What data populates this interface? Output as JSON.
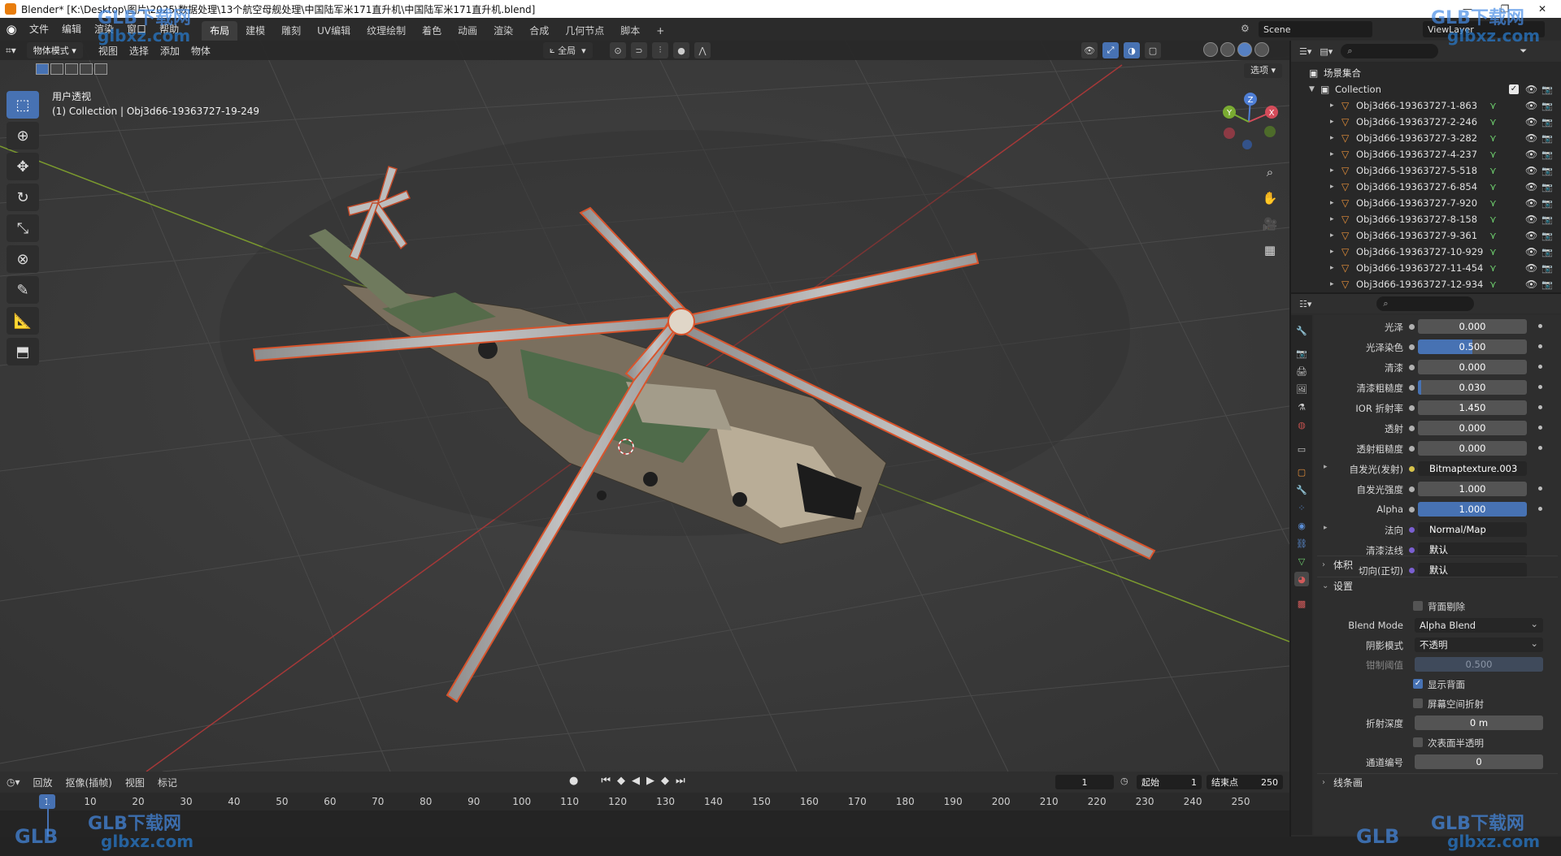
{
  "window": {
    "title": "Blender* [K:\\Desktop\\图片\\2025\\数据处理\\13个航空母舰处理\\中国陆军米171直升机\\中国陆军米171直升机.blend]",
    "buttons": [
      "—",
      "❐",
      "✕"
    ]
  },
  "menu": {
    "items": [
      "文件",
      "编辑",
      "渲染",
      "窗口",
      "帮助"
    ],
    "workspaces": [
      "布局",
      "建模",
      "雕刻",
      "UV编辑",
      "纹理绘制",
      "着色",
      "动画",
      "渲染",
      "合成",
      "几何节点",
      "脚本",
      "+"
    ],
    "active_workspace": "布局",
    "scene": "Scene",
    "view_layer": "ViewLayer"
  },
  "viewport": {
    "mode": "物体模式",
    "header_menus": [
      "视图",
      "选择",
      "添加",
      "物体"
    ],
    "transform_orientation": "全局",
    "options_label": "选项",
    "info_line1": "用户透视",
    "info_line2": "(1) Collection | Obj3d66-19363727-19-249",
    "gizmo_axes": [
      "Z",
      "X",
      "Y"
    ]
  },
  "toolbar": {
    "tools": [
      "select-box-icon",
      "cursor-icon",
      "move-icon",
      "rotate-icon",
      "scale-icon",
      "transform-icon",
      "annotate-icon",
      "measure-icon",
      "add-cube-icon"
    ]
  },
  "timeline": {
    "menus": [
      "回放",
      "抠像(插帧)",
      "视图",
      "标记"
    ],
    "current_frame": "1",
    "start_label": "起始",
    "start": "1",
    "end_label": "结束点",
    "end": "250",
    "ticks": [
      "1",
      "10",
      "20",
      "30",
      "40",
      "50",
      "60",
      "70",
      "80",
      "90",
      "100",
      "110",
      "120",
      "130",
      "140",
      "150",
      "160",
      "170",
      "180",
      "190",
      "200",
      "210",
      "220",
      "230",
      "240",
      "250"
    ]
  },
  "outliner": {
    "scene_collection": "场景集合",
    "collection": "Collection",
    "objects": [
      "Obj3d66-19363727-1-863",
      "Obj3d66-19363727-2-246",
      "Obj3d66-19363727-3-282",
      "Obj3d66-19363727-4-237",
      "Obj3d66-19363727-5-518",
      "Obj3d66-19363727-6-854",
      "Obj3d66-19363727-7-920",
      "Obj3d66-19363727-8-158",
      "Obj3d66-19363727-9-361",
      "Obj3d66-19363727-10-929",
      "Obj3d66-19363727-11-454",
      "Obj3d66-19363727-12-934"
    ]
  },
  "properties": {
    "fields": [
      {
        "label": "光泽",
        "value": "0.000",
        "style": "plain"
      },
      {
        "label": "光泽染色",
        "value": "0.500",
        "style": "half"
      },
      {
        "label": "清漆",
        "value": "0.000",
        "style": "plain"
      },
      {
        "label": "清漆粗糙度",
        "value": "0.030",
        "style": "partial"
      },
      {
        "label": "IOR 折射率",
        "value": "1.450",
        "style": "plain"
      },
      {
        "label": "透射",
        "value": "0.000",
        "style": "plain"
      },
      {
        "label": "透射粗糙度",
        "value": "0.000",
        "style": "plain"
      },
      {
        "label": "自发光(发射)",
        "value": "Bitmaptexture.003",
        "style": "text-yellow"
      },
      {
        "label": "自发光强度",
        "value": "1.000",
        "style": "plain"
      },
      {
        "label": "Alpha",
        "value": "1.000",
        "style": "blue"
      },
      {
        "label": "法向",
        "value": "Normal/Map",
        "style": "text-purple"
      },
      {
        "label": "清漆法线",
        "value": "默认",
        "style": "text-purple"
      },
      {
        "label": "切向(正切)",
        "value": "默认",
        "style": "text-purple"
      }
    ],
    "section_volume": "体积",
    "section_settings": "设置",
    "backface_culling": "背面剔除",
    "blend_mode_label": "Blend Mode",
    "blend_mode": "Alpha Blend",
    "shadow_mode_label": "阴影模式",
    "shadow_mode": "不透明",
    "clip_threshold_label": "钳制阈值",
    "clip_threshold": "0.500",
    "show_backface": "显示背面",
    "screen_space_refraction": "屏幕空间折射",
    "refraction_depth_label": "折射深度",
    "refraction_depth": "0 m",
    "subsurface_translucency": "次表面半透明",
    "pass_index_label": "通道编号",
    "pass_index": "0",
    "line_art": "线条画"
  },
  "watermarks": {
    "brand": "GLB下载网",
    "url": "glbxz.com",
    "logo": "GLB"
  },
  "colors": {
    "accent": "#4772b3",
    "orange": "#e87d0d",
    "viewport_bg": "#3b3b3b"
  }
}
